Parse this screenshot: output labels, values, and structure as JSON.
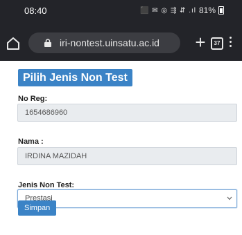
{
  "status_bar": {
    "time": "08:40",
    "icons_text": "⬛ ✉ ◎ ⇶ ⇵ .ıl",
    "battery": "81%"
  },
  "browser": {
    "url": "iri-nontest.uinsatu.ac.id",
    "tab_count": "37",
    "new_tab_symbol": "+"
  },
  "form": {
    "title": "Pilih Jenis Non Test",
    "no_reg_label": "No Reg:",
    "no_reg_value": "1654686960",
    "nama_label": "Nama :",
    "nama_value": "IRDINA MAZIDAH",
    "jenis_label": "Jenis Non Test:",
    "jenis_selected": "Prestasi",
    "submit_label": "Simpan"
  },
  "colors": {
    "primary": "#3b83c6",
    "browser_bar": "#232429"
  }
}
